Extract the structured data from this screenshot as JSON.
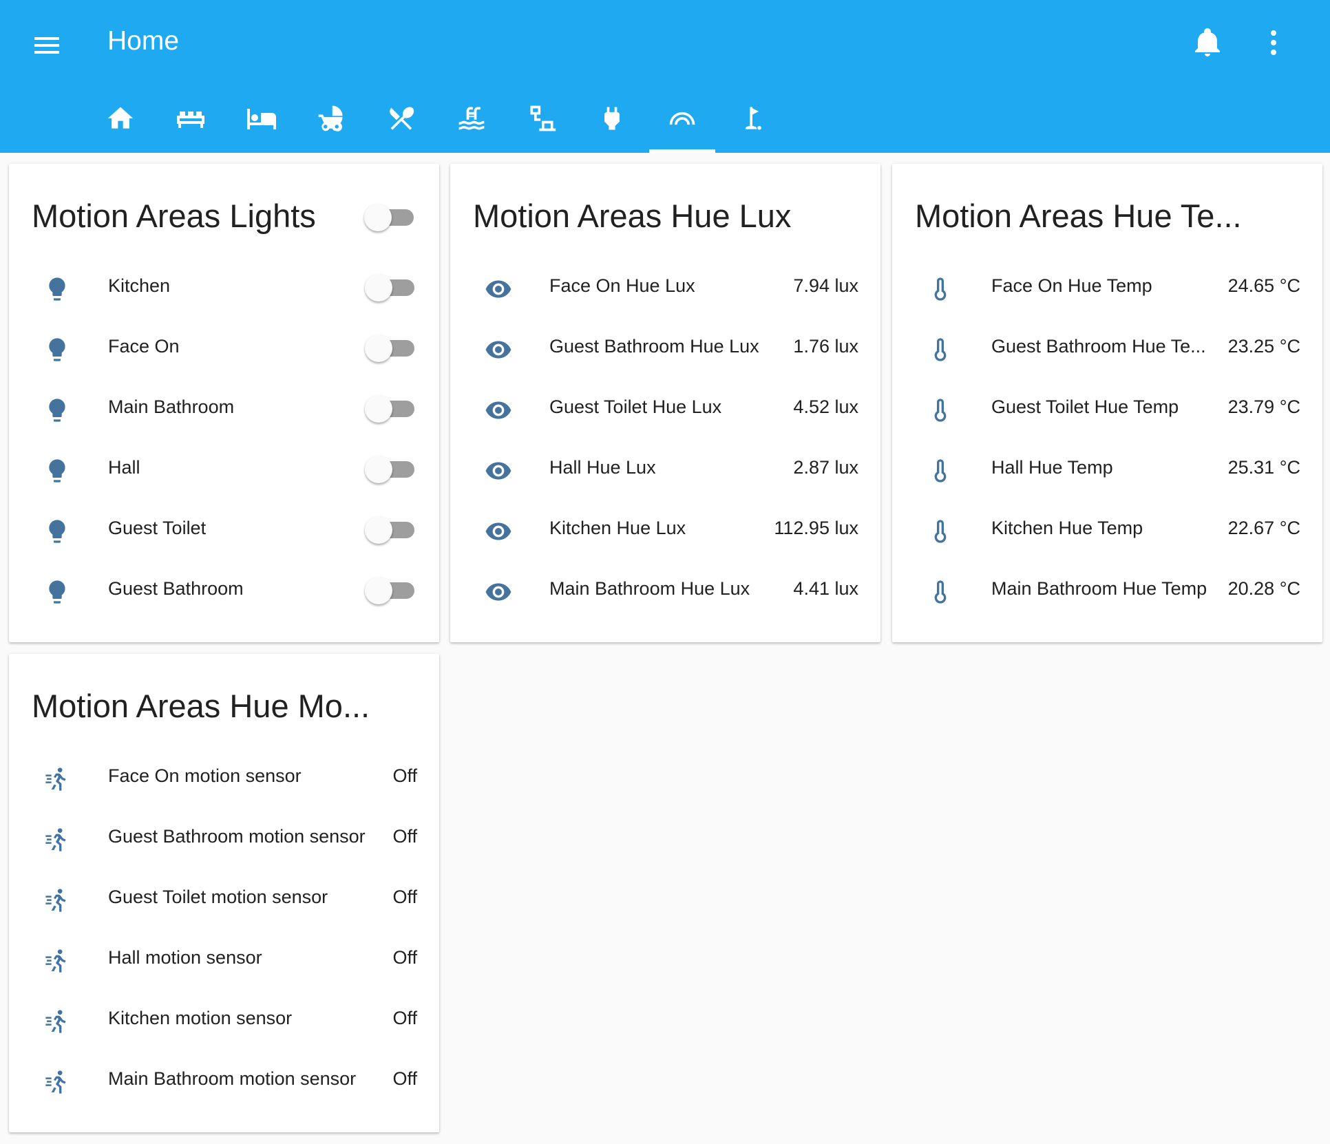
{
  "header": {
    "title": "Home",
    "menu_icon": "menu-icon",
    "notifications_icon": "bell-icon",
    "more_icon": "more-vertical-icon",
    "background": "#1fa9f1"
  },
  "tabs": [
    {
      "icon": "home-icon",
      "active": false
    },
    {
      "icon": "sofa-icon",
      "active": false
    },
    {
      "icon": "bed-icon",
      "active": false
    },
    {
      "icon": "baby-carriage-icon",
      "active": false
    },
    {
      "icon": "silverware-icon",
      "active": false
    },
    {
      "icon": "pool-icon",
      "active": false
    },
    {
      "icon": "network-icon",
      "active": false
    },
    {
      "icon": "power-plug-icon",
      "active": false
    },
    {
      "icon": "motion-areas-icon",
      "active": true
    },
    {
      "icon": "golf-icon",
      "active": false
    }
  ],
  "cards": {
    "lights": {
      "title": "Motion Areas Lights",
      "master_toggle": false,
      "items": [
        {
          "name": "Kitchen",
          "on": false
        },
        {
          "name": "Face On",
          "on": false
        },
        {
          "name": "Main Bathroom",
          "on": false
        },
        {
          "name": "Hall",
          "on": false
        },
        {
          "name": "Guest Toilet",
          "on": false
        },
        {
          "name": "Guest Bathroom",
          "on": false
        }
      ]
    },
    "lux": {
      "title": "Motion Areas Hue Lux",
      "items": [
        {
          "name": "Face On Hue Lux",
          "value": "7.94 lux"
        },
        {
          "name": "Guest Bathroom Hue Lux",
          "value": "1.76 lux"
        },
        {
          "name": "Guest Toilet Hue Lux",
          "value": "4.52 lux"
        },
        {
          "name": "Hall Hue Lux",
          "value": "2.87 lux"
        },
        {
          "name": "Kitchen Hue Lux",
          "value": "112.95 lux"
        },
        {
          "name": "Main Bathroom Hue Lux",
          "value": "4.41 lux"
        }
      ]
    },
    "temp": {
      "title": "Motion Areas Hue Te...",
      "items": [
        {
          "name": "Face On Hue Temp",
          "value": "24.65 °C"
        },
        {
          "name": "Guest Bathroom Hue Te...",
          "value": "23.25 °C"
        },
        {
          "name": "Guest Toilet Hue Temp",
          "value": "23.79 °C"
        },
        {
          "name": "Hall Hue Temp",
          "value": "25.31 °C"
        },
        {
          "name": "Kitchen Hue Temp",
          "value": "22.67 °C"
        },
        {
          "name": "Main Bathroom Hue Temp",
          "value": "20.28 °C"
        }
      ]
    },
    "motion": {
      "title": "Motion Areas Hue Mo...",
      "items": [
        {
          "name": "Face On motion sensor",
          "value": "Off"
        },
        {
          "name": "Guest Bathroom motion sensor",
          "value": "Off"
        },
        {
          "name": "Guest Toilet motion sensor",
          "value": "Off"
        },
        {
          "name": "Hall motion sensor",
          "value": "Off"
        },
        {
          "name": "Kitchen motion sensor",
          "value": "Off"
        },
        {
          "name": "Main Bathroom motion sensor",
          "value": "Off"
        }
      ]
    }
  },
  "colors": {
    "icon": "#44739e",
    "toggle_off_track": "#9e9e9e"
  }
}
